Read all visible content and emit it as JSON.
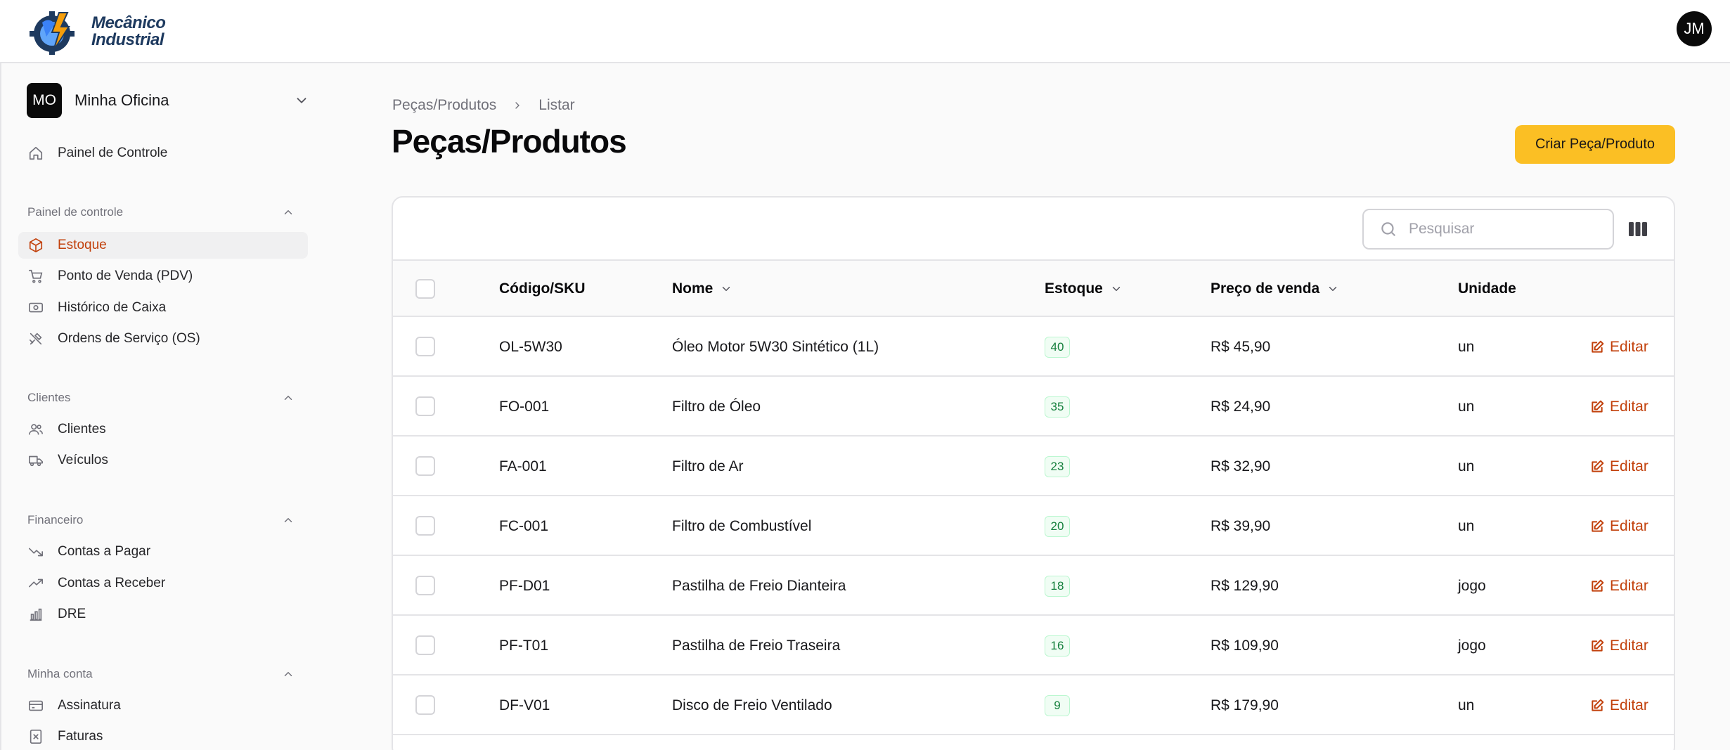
{
  "app": {
    "logo_line1": "Mecânico",
    "logo_line2": "Industrial",
    "user_initials": "JM"
  },
  "sidebar": {
    "org_initials": "MO",
    "org_name": "Minha Oficina",
    "dashboard": {
      "label": "Painel de Controle",
      "icon": "home-icon"
    },
    "groups": [
      {
        "label": "Painel de controle",
        "items": [
          {
            "label": "Estoque",
            "icon": "cube-icon",
            "active": true
          },
          {
            "label": "Ponto de Venda (PDV)",
            "icon": "cart-icon"
          },
          {
            "label": "Histórico de Caixa",
            "icon": "cash-icon"
          },
          {
            "label": "Ordens de Serviço (OS)",
            "icon": "tools-icon"
          }
        ]
      },
      {
        "label": "Clientes",
        "items": [
          {
            "label": "Clientes",
            "icon": "users-icon"
          },
          {
            "label": "Veículos",
            "icon": "truck-icon"
          }
        ]
      },
      {
        "label": "Financeiro",
        "items": [
          {
            "label": "Contas a Pagar",
            "icon": "trending-down-icon"
          },
          {
            "label": "Contas a Receber",
            "icon": "trending-up-icon"
          },
          {
            "label": "DRE",
            "icon": "bar-chart-icon"
          }
        ]
      },
      {
        "label": "Minha conta",
        "items": [
          {
            "label": "Assinatura",
            "icon": "credit-card-icon"
          },
          {
            "label": "Faturas",
            "icon": "invoice-icon"
          }
        ]
      }
    ]
  },
  "main": {
    "breadcrumb": [
      "Peças/Produtos",
      "Listar"
    ],
    "title": "Peças/Produtos",
    "create_label": "Criar Peça/Produto",
    "search_placeholder": "Pesquisar",
    "columns": {
      "sku": "Código/SKU",
      "name": "Nome",
      "stock": "Estoque",
      "price": "Preço de venda",
      "unit": "Unidade"
    },
    "edit_label": "Editar",
    "rows": [
      {
        "sku": "OL-5W30",
        "name": "Óleo Motor 5W30 Sintético (1L)",
        "stock": "40",
        "price": "R$ 45,90",
        "unit": "un"
      },
      {
        "sku": "FO-001",
        "name": "Filtro de Óleo",
        "stock": "35",
        "price": "R$ 24,90",
        "unit": "un"
      },
      {
        "sku": "FA-001",
        "name": "Filtro de Ar",
        "stock": "23",
        "price": "R$ 32,90",
        "unit": "un"
      },
      {
        "sku": "FC-001",
        "name": "Filtro de Combustível",
        "stock": "20",
        "price": "R$ 39,90",
        "unit": "un"
      },
      {
        "sku": "PF-D01",
        "name": "Pastilha de Freio Dianteira",
        "stock": "18",
        "price": "R$ 129,90",
        "unit": "jogo"
      },
      {
        "sku": "PF-T01",
        "name": "Pastilha de Freio Traseira",
        "stock": "16",
        "price": "R$ 109,90",
        "unit": "jogo"
      },
      {
        "sku": "DF-V01",
        "name": "Disco de Freio Ventilado",
        "stock": "9",
        "price": "R$ 179,90",
        "unit": "un"
      }
    ]
  },
  "colors": {
    "accent": "#c2410c",
    "primary_button": "#fbbf24",
    "stock_badge": "#15803d"
  }
}
